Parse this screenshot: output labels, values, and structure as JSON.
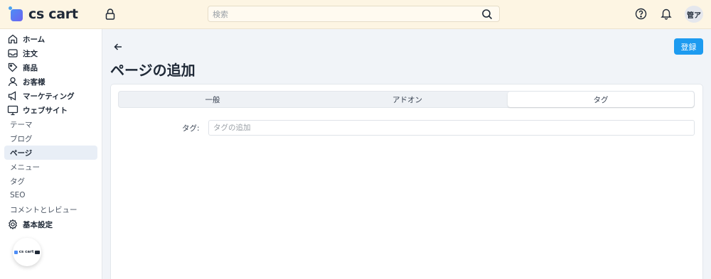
{
  "header": {
    "logo_text": "cs cart",
    "search_placeholder": "検索",
    "avatar_text": "管ア"
  },
  "sidebar": {
    "items": [
      {
        "label": "ホーム",
        "icon": "home-icon"
      },
      {
        "label": "注文",
        "icon": "inbox-icon"
      },
      {
        "label": "商品",
        "icon": "tag-icon"
      },
      {
        "label": "お客様",
        "icon": "user-icon"
      },
      {
        "label": "マーケティング",
        "icon": "megaphone-icon"
      },
      {
        "label": "ウェブサイト",
        "icon": "monitor-icon"
      }
    ],
    "website_sub": [
      {
        "label": "テーマ",
        "active": false
      },
      {
        "label": "ブログ",
        "active": false
      },
      {
        "label": "ページ",
        "active": true
      },
      {
        "label": "メニュー",
        "active": false
      },
      {
        "label": "タグ",
        "active": false
      },
      {
        "label": "SEO",
        "active": false
      },
      {
        "label": "コメントとレビュー",
        "active": false
      }
    ],
    "settings": {
      "label": "基本設定",
      "icon": "gear-icon"
    },
    "float_logo_text": "cs cart"
  },
  "main": {
    "title": "ページの追加",
    "save_label": "登録",
    "tabs": [
      {
        "label": "一般",
        "active": false
      },
      {
        "label": "アドオン",
        "active": false
      },
      {
        "label": "タグ",
        "active": true
      }
    ],
    "tag_field": {
      "label": "タグ:",
      "placeholder": "タグの追加"
    }
  },
  "colors": {
    "accent": "#1d9bf0",
    "topbar_bg": "#fdf5e3",
    "active_nav_bg": "#e8eef6"
  }
}
